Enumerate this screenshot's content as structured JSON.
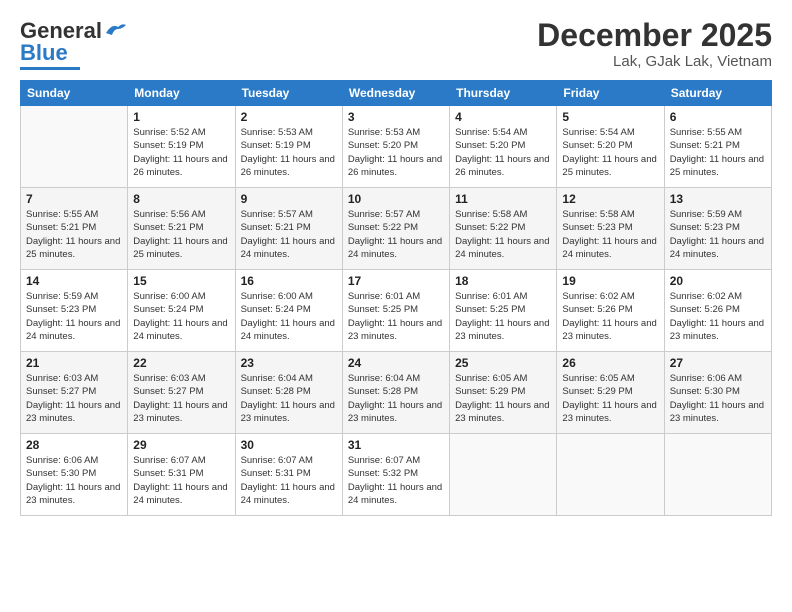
{
  "header": {
    "logo_general": "General",
    "logo_blue": "Blue",
    "month_title": "December 2025",
    "location": "Lak, GJak Lak, Vietnam"
  },
  "weekdays": [
    "Sunday",
    "Monday",
    "Tuesday",
    "Wednesday",
    "Thursday",
    "Friday",
    "Saturday"
  ],
  "rows": [
    [
      {
        "day": "",
        "sunrise": "",
        "sunset": "",
        "daylight": ""
      },
      {
        "day": "1",
        "sunrise": "Sunrise: 5:52 AM",
        "sunset": "Sunset: 5:19 PM",
        "daylight": "Daylight: 11 hours and 26 minutes."
      },
      {
        "day": "2",
        "sunrise": "Sunrise: 5:53 AM",
        "sunset": "Sunset: 5:19 PM",
        "daylight": "Daylight: 11 hours and 26 minutes."
      },
      {
        "day": "3",
        "sunrise": "Sunrise: 5:53 AM",
        "sunset": "Sunset: 5:20 PM",
        "daylight": "Daylight: 11 hours and 26 minutes."
      },
      {
        "day": "4",
        "sunrise": "Sunrise: 5:54 AM",
        "sunset": "Sunset: 5:20 PM",
        "daylight": "Daylight: 11 hours and 26 minutes."
      },
      {
        "day": "5",
        "sunrise": "Sunrise: 5:54 AM",
        "sunset": "Sunset: 5:20 PM",
        "daylight": "Daylight: 11 hours and 25 minutes."
      },
      {
        "day": "6",
        "sunrise": "Sunrise: 5:55 AM",
        "sunset": "Sunset: 5:21 PM",
        "daylight": "Daylight: 11 hours and 25 minutes."
      }
    ],
    [
      {
        "day": "7",
        "sunrise": "Sunrise: 5:55 AM",
        "sunset": "Sunset: 5:21 PM",
        "daylight": "Daylight: 11 hours and 25 minutes."
      },
      {
        "day": "8",
        "sunrise": "Sunrise: 5:56 AM",
        "sunset": "Sunset: 5:21 PM",
        "daylight": "Daylight: 11 hours and 25 minutes."
      },
      {
        "day": "9",
        "sunrise": "Sunrise: 5:57 AM",
        "sunset": "Sunset: 5:21 PM",
        "daylight": "Daylight: 11 hours and 24 minutes."
      },
      {
        "day": "10",
        "sunrise": "Sunrise: 5:57 AM",
        "sunset": "Sunset: 5:22 PM",
        "daylight": "Daylight: 11 hours and 24 minutes."
      },
      {
        "day": "11",
        "sunrise": "Sunrise: 5:58 AM",
        "sunset": "Sunset: 5:22 PM",
        "daylight": "Daylight: 11 hours and 24 minutes."
      },
      {
        "day": "12",
        "sunrise": "Sunrise: 5:58 AM",
        "sunset": "Sunset: 5:23 PM",
        "daylight": "Daylight: 11 hours and 24 minutes."
      },
      {
        "day": "13",
        "sunrise": "Sunrise: 5:59 AM",
        "sunset": "Sunset: 5:23 PM",
        "daylight": "Daylight: 11 hours and 24 minutes."
      }
    ],
    [
      {
        "day": "14",
        "sunrise": "Sunrise: 5:59 AM",
        "sunset": "Sunset: 5:23 PM",
        "daylight": "Daylight: 11 hours and 24 minutes."
      },
      {
        "day": "15",
        "sunrise": "Sunrise: 6:00 AM",
        "sunset": "Sunset: 5:24 PM",
        "daylight": "Daylight: 11 hours and 24 minutes."
      },
      {
        "day": "16",
        "sunrise": "Sunrise: 6:00 AM",
        "sunset": "Sunset: 5:24 PM",
        "daylight": "Daylight: 11 hours and 24 minutes."
      },
      {
        "day": "17",
        "sunrise": "Sunrise: 6:01 AM",
        "sunset": "Sunset: 5:25 PM",
        "daylight": "Daylight: 11 hours and 23 minutes."
      },
      {
        "day": "18",
        "sunrise": "Sunrise: 6:01 AM",
        "sunset": "Sunset: 5:25 PM",
        "daylight": "Daylight: 11 hours and 23 minutes."
      },
      {
        "day": "19",
        "sunrise": "Sunrise: 6:02 AM",
        "sunset": "Sunset: 5:26 PM",
        "daylight": "Daylight: 11 hours and 23 minutes."
      },
      {
        "day": "20",
        "sunrise": "Sunrise: 6:02 AM",
        "sunset": "Sunset: 5:26 PM",
        "daylight": "Daylight: 11 hours and 23 minutes."
      }
    ],
    [
      {
        "day": "21",
        "sunrise": "Sunrise: 6:03 AM",
        "sunset": "Sunset: 5:27 PM",
        "daylight": "Daylight: 11 hours and 23 minutes."
      },
      {
        "day": "22",
        "sunrise": "Sunrise: 6:03 AM",
        "sunset": "Sunset: 5:27 PM",
        "daylight": "Daylight: 11 hours and 23 minutes."
      },
      {
        "day": "23",
        "sunrise": "Sunrise: 6:04 AM",
        "sunset": "Sunset: 5:28 PM",
        "daylight": "Daylight: 11 hours and 23 minutes."
      },
      {
        "day": "24",
        "sunrise": "Sunrise: 6:04 AM",
        "sunset": "Sunset: 5:28 PM",
        "daylight": "Daylight: 11 hours and 23 minutes."
      },
      {
        "day": "25",
        "sunrise": "Sunrise: 6:05 AM",
        "sunset": "Sunset: 5:29 PM",
        "daylight": "Daylight: 11 hours and 23 minutes."
      },
      {
        "day": "26",
        "sunrise": "Sunrise: 6:05 AM",
        "sunset": "Sunset: 5:29 PM",
        "daylight": "Daylight: 11 hours and 23 minutes."
      },
      {
        "day": "27",
        "sunrise": "Sunrise: 6:06 AM",
        "sunset": "Sunset: 5:30 PM",
        "daylight": "Daylight: 11 hours and 23 minutes."
      }
    ],
    [
      {
        "day": "28",
        "sunrise": "Sunrise: 6:06 AM",
        "sunset": "Sunset: 5:30 PM",
        "daylight": "Daylight: 11 hours and 23 minutes."
      },
      {
        "day": "29",
        "sunrise": "Sunrise: 6:07 AM",
        "sunset": "Sunset: 5:31 PM",
        "daylight": "Daylight: 11 hours and 24 minutes."
      },
      {
        "day": "30",
        "sunrise": "Sunrise: 6:07 AM",
        "sunset": "Sunset: 5:31 PM",
        "daylight": "Daylight: 11 hours and 24 minutes."
      },
      {
        "day": "31",
        "sunrise": "Sunrise: 6:07 AM",
        "sunset": "Sunset: 5:32 PM",
        "daylight": "Daylight: 11 hours and 24 minutes."
      },
      {
        "day": "",
        "sunrise": "",
        "sunset": "",
        "daylight": ""
      },
      {
        "day": "",
        "sunrise": "",
        "sunset": "",
        "daylight": ""
      },
      {
        "day": "",
        "sunrise": "",
        "sunset": "",
        "daylight": ""
      }
    ]
  ]
}
